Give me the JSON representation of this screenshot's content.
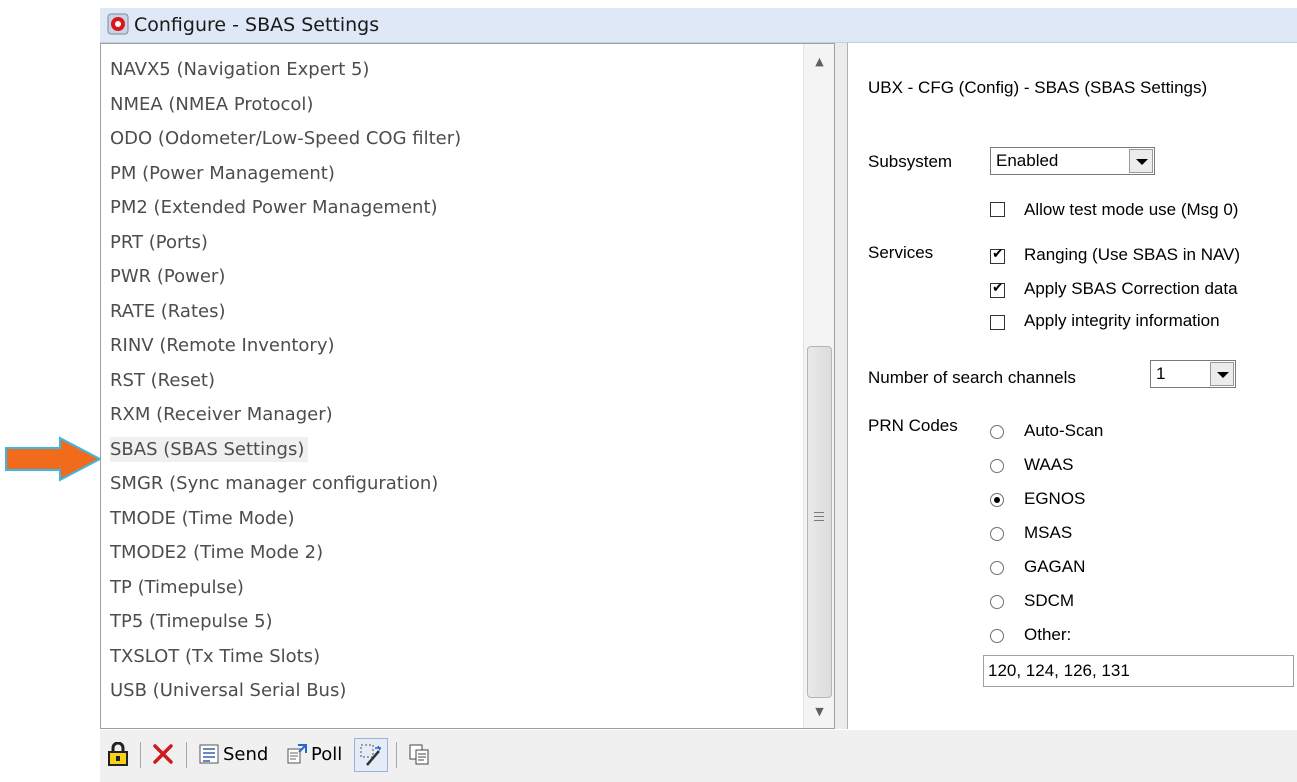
{
  "window": {
    "title": "Configure - SBAS Settings"
  },
  "list": {
    "items": [
      "NAVX5 (Navigation Expert 5)",
      "NMEA (NMEA Protocol)",
      "ODO (Odometer/Low-Speed COG filter)",
      "PM (Power Management)",
      "PM2 (Extended Power Management)",
      "PRT (Ports)",
      "PWR (Power)",
      "RATE (Rates)",
      "RINV (Remote Inventory)",
      "RST (Reset)",
      "RXM (Receiver Manager)",
      "SBAS (SBAS Settings)",
      "SMGR (Sync manager configuration)",
      "TMODE (Time Mode)",
      "TMODE2 (Time Mode 2)",
      "TP (Timepulse)",
      "TP5 (Timepulse 5)",
      "TXSLOT (Tx Time Slots)",
      "USB (Universal Serial Bus)"
    ],
    "selected": "SBAS (SBAS Settings)"
  },
  "panel": {
    "title": "UBX - CFG (Config) - SBAS (SBAS Settings)",
    "subsystem_label": "Subsystem",
    "subsystem_value": "Enabled",
    "allow_test_mode": {
      "label": "Allow test mode use (Msg 0)",
      "checked": false
    },
    "services_label": "Services",
    "ranging": {
      "label": "Ranging (Use SBAS in NAV)",
      "checked": true
    },
    "apply_correction": {
      "label": "Apply SBAS Correction data",
      "checked": true
    },
    "apply_integrity": {
      "label": "Apply integrity information",
      "checked": false
    },
    "channels_label": "Number of search channels",
    "channels_value": "1",
    "prn_label": "PRN Codes",
    "prn_options": [
      "Auto-Scan",
      "WAAS",
      "EGNOS",
      "MSAS",
      "GAGAN",
      "SDCM",
      "Other:"
    ],
    "prn_selected": "EGNOS",
    "other_value": "120, 124, 126, 131"
  },
  "toolbar": {
    "send_label": "Send",
    "poll_label": "Poll"
  },
  "colors": {
    "arrow": "#f26a1b",
    "arrow_outline": "#39b9e6",
    "titlebar": "#dfe8f6"
  }
}
